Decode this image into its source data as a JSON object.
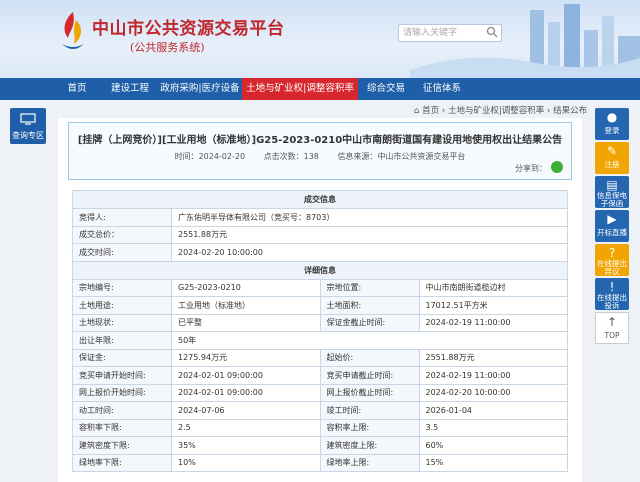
{
  "header": {
    "title": "中山市公共资源交易平台",
    "subtitle": "(公共服务系统)",
    "search_placeholder": "请输入关键字"
  },
  "nav": {
    "items": [
      {
        "label": "首页",
        "active": false
      },
      {
        "label": "建设工程",
        "active": false
      },
      {
        "label": "政府采购|医疗设备",
        "active": false
      },
      {
        "label": "土地与矿业权|调整容积率",
        "active": true
      },
      {
        "label": "综合交易",
        "active": false
      },
      {
        "label": "征信体系",
        "active": false
      }
    ]
  },
  "side_left": {
    "label": "查询专区"
  },
  "side_right": {
    "items": [
      {
        "label": "登录",
        "glyph": "●",
        "color": "blue"
      },
      {
        "label": "注册",
        "glyph": "✎",
        "color": "yellow"
      },
      {
        "label": "信息保电子保函",
        "glyph": "▤",
        "color": "blue"
      },
      {
        "label": "开标直播",
        "glyph": "▶",
        "color": "blue"
      },
      {
        "label": "在线提出异议",
        "glyph": "?",
        "color": "yellow"
      },
      {
        "label": "在线提出投诉",
        "glyph": "!",
        "color": "blue"
      },
      {
        "label": "TOP",
        "glyph": "↑",
        "color": "top"
      }
    ]
  },
  "breadcrumb": {
    "home": "首页",
    "level1": "土地与矿业权|调整容积率",
    "level2": "结果公布"
  },
  "announcement": {
    "title": "[挂牌（上网竞价）][工业用地（标准地）]G25-2023-0210中山市南朗街道国有建设用地使用权出让结果公告",
    "time_label": "时间：",
    "time": "2024-02-20",
    "clicks_label": "点击次数：",
    "clicks": "138",
    "source_label": "信息来源：",
    "source": "中山市公共资源交易平台",
    "share_label": "分享到："
  },
  "table": {
    "section1": "成交信息",
    "deal": [
      {
        "label": "竞得人:",
        "value": "广东佑明半导体有限公司（竞买号：8703）"
      },
      {
        "label": "成交总价：",
        "value": "2551.88万元"
      },
      {
        "label": "成交时间:",
        "value": "2024-02-20 10:00:00"
      }
    ],
    "section2": "详细信息",
    "detail": [
      [
        "宗地编号:",
        "G25-2023-0210",
        "宗地位置:",
        "中山市南朗街道榄边村"
      ],
      [
        "土地用途:",
        "工业用地（标准地）",
        "土地面积:",
        "17012.51平方米"
      ],
      [
        "土地现状:",
        "已平整",
        "保证金截止时间:",
        "2024-02-19 11:00:00"
      ],
      [
        "出让年限:",
        "50年",
        "",
        ""
      ],
      [
        "保证金:",
        "1275.94万元",
        "起始价:",
        "2551.88万元"
      ],
      [
        "竞买申请开始时间:",
        "2024-02-01 09:00:00",
        "竞买申请截止时间:",
        "2024-02-19 11:00:00"
      ],
      [
        "网上报价开始时间:",
        "2024-02-01 09:00:00",
        "网上报价截止时间:",
        "2024-02-20 10:00:00"
      ],
      [
        "动工时间:",
        "2024-07-06",
        "竣工时间:",
        "2026-01-04"
      ],
      [
        "容积率下限:",
        "2.5",
        "容积率上限:",
        "3.5"
      ],
      [
        "建筑密度下限:",
        "35%",
        "建筑密度上限:",
        "60%"
      ],
      [
        "绿地率下限:",
        "10%",
        "绿地率上限:",
        "15%"
      ]
    ]
  },
  "colors": {
    "nav_bg": "#1f5ea8",
    "nav_active": "#d8262e",
    "title_red": "#c0262c",
    "accent_yellow": "#f0a500"
  }
}
